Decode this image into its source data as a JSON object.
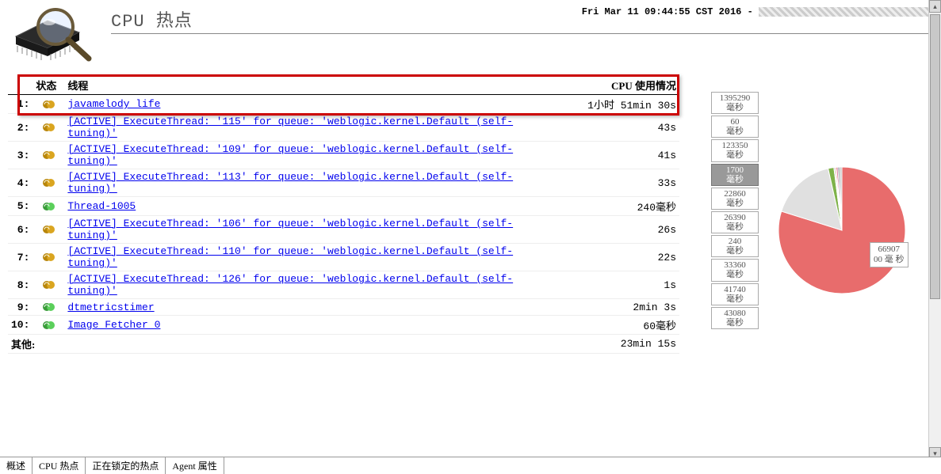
{
  "header": {
    "title": "CPU 热点",
    "timestamp": "Fri Mar 11 09:44:55 CST 2016 - "
  },
  "table": {
    "col_status": "状态",
    "col_thread": "线程",
    "col_cpu": "CPU 使用情况",
    "rows": [
      {
        "idx": "1:",
        "status": "runnable-gold",
        "name": "javamelody life",
        "cpu": "1小时 51min 30s"
      },
      {
        "idx": "2:",
        "status": "runnable-gold",
        "name": "[ACTIVE] ExecuteThread: '115' for queue: 'weblogic.kernel.Default (self-tuning)'",
        "cpu": "43s"
      },
      {
        "idx": "3:",
        "status": "runnable-gold",
        "name": "[ACTIVE] ExecuteThread: '109' for queue: 'weblogic.kernel.Default (self-tuning)'",
        "cpu": "41s"
      },
      {
        "idx": "4:",
        "status": "runnable-gold",
        "name": "[ACTIVE] ExecuteThread: '113' for queue: 'weblogic.kernel.Default (self-tuning)'",
        "cpu": "33s"
      },
      {
        "idx": "5:",
        "status": "waiting-green",
        "name": "Thread-1005",
        "cpu": "240毫秒"
      },
      {
        "idx": "6:",
        "status": "runnable-gold",
        "name": "[ACTIVE] ExecuteThread: '106' for queue: 'weblogic.kernel.Default (self-tuning)'",
        "cpu": "26s"
      },
      {
        "idx": "7:",
        "status": "runnable-gold",
        "name": "[ACTIVE] ExecuteThread: '110' for queue: 'weblogic.kernel.Default (self-tuning)'",
        "cpu": "22s"
      },
      {
        "idx": "8:",
        "status": "runnable-gold",
        "name": "[ACTIVE] ExecuteThread: '126' for queue: 'weblogic.kernel.Default (self-tuning)'",
        "cpu": "1s"
      },
      {
        "idx": "9:",
        "status": "waiting-green",
        "name": "dtmetricstimer",
        "cpu": "2min 3s"
      },
      {
        "idx": "10:",
        "status": "waiting-green",
        "name": "Image Fetcher 0",
        "cpu": "60毫秒"
      }
    ],
    "others_label": "其他:",
    "others_cpu": "23min 15s"
  },
  "chart_data": {
    "type": "pie",
    "title": "",
    "unit": "毫秒",
    "legend": [
      {
        "label": "1395290 毫秒",
        "value": 1395290,
        "selected": false
      },
      {
        "label": "60 毫秒",
        "value": 60,
        "selected": false
      },
      {
        "label": "123350 毫秒",
        "value": 123350,
        "selected": false
      },
      {
        "label": "1700 毫秒",
        "value": 1700,
        "selected": true
      },
      {
        "label": "22860 毫秒",
        "value": 22860,
        "selected": false
      },
      {
        "label": "26390 毫秒",
        "value": 26390,
        "selected": false
      },
      {
        "label": "240 毫秒",
        "value": 240,
        "selected": false
      },
      {
        "label": "33360 毫秒",
        "value": 33360,
        "selected": false
      },
      {
        "label": "41740 毫秒",
        "value": 41740,
        "selected": false
      },
      {
        "label": "43080 毫秒",
        "value": 43080,
        "selected": false
      }
    ],
    "callout": {
      "label": "6690700 毫秒",
      "value": 6690700
    }
  },
  "tabs": [
    {
      "label": "概述",
      "active": false
    },
    {
      "label": "CPU 热点",
      "active": true
    },
    {
      "label": "正在锁定的热点",
      "active": false
    },
    {
      "label": "Agent 属性",
      "active": false
    }
  ]
}
